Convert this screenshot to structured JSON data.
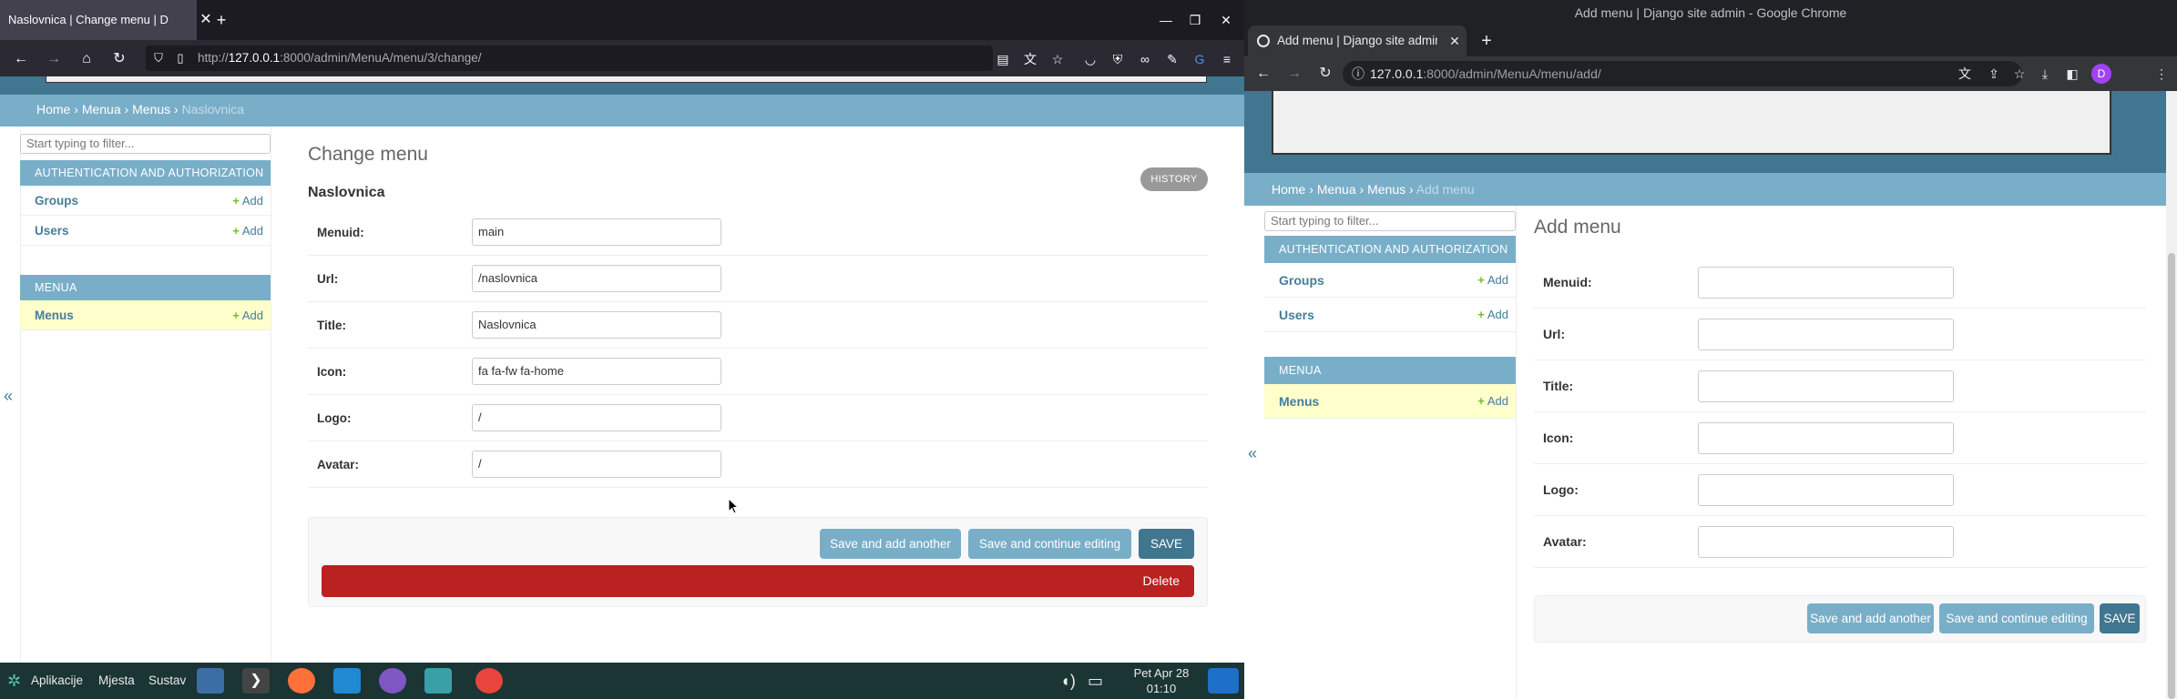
{
  "left_window": {
    "tab_title": "Naslovnica | Change menu | D",
    "url_host": "127.0.0.1",
    "url_prefix": "http://",
    "url_rest": ":8000/admin/MenuA/menu/3/change/",
    "breadcrumb": {
      "home": "Home",
      "app": "Menua",
      "model": "Menus",
      "current": "Naslovnica"
    },
    "sidebar": {
      "filter_placeholder": "Start typing to filter...",
      "auth_caption": "AUTHENTICATION AND AUTHORIZATION",
      "groups": "Groups",
      "users": "Users",
      "menua_caption": "MENUA",
      "menus": "Menus",
      "add_label": "Add",
      "collapse": "«"
    },
    "page_title": "Change menu",
    "object_title": "Naslovnica",
    "history_label": "HISTORY",
    "fields": [
      {
        "label": "Menuid:",
        "value": "main"
      },
      {
        "label": "Url:",
        "value": "/naslovnica"
      },
      {
        "label": "Title:",
        "value": "Naslovnica"
      },
      {
        "label": "Icon:",
        "value": "fa fa-fw fa-home"
      },
      {
        "label": "Logo:",
        "value": "/"
      },
      {
        "label": "Avatar:",
        "value": "/"
      }
    ],
    "buttons": {
      "save_add": "Save and add another",
      "save_continue": "Save and continue editing",
      "save": "SAVE",
      "delete": "Delete"
    }
  },
  "taskbar": {
    "apps_label": "Aplikacije",
    "places_label": "Mjesta",
    "system_label": "Sustav",
    "clock_line1": "Pet Apr 28",
    "clock_line2": "01:10"
  },
  "right_window": {
    "window_title": "Add menu | Django site admin - Google Chrome",
    "tab_title": "Add menu | Django site admin",
    "url_host": "127.0.0.1",
    "url_rest": ":8000/admin/MenuA/menu/add/",
    "profile_initial": "D",
    "breadcrumb": {
      "home": "Home",
      "app": "Menua",
      "model": "Menus",
      "current": "Add menu"
    },
    "sidebar": {
      "filter_placeholder": "Start typing to filter...",
      "auth_caption": "AUTHENTICATION AND AUTHORIZATION",
      "groups": "Groups",
      "users": "Users",
      "menua_caption": "MENUA",
      "menus": "Menus",
      "add_label": "Add",
      "collapse": "«"
    },
    "page_title": "Add menu",
    "fields": [
      {
        "label": "Menuid:"
      },
      {
        "label": "Url:"
      },
      {
        "label": "Title:"
      },
      {
        "label": "Icon:"
      },
      {
        "label": "Logo:"
      },
      {
        "label": "Avatar:"
      }
    ],
    "buttons": {
      "save_add": "Save and add another",
      "save_continue": "Save and continue editing",
      "save": "SAVE"
    }
  },
  "colors": {
    "header": "#417690",
    "module": "#79aec8",
    "delete": "#ba2121",
    "link": "#447e9b",
    "add_plus": "#70bf2b"
  }
}
